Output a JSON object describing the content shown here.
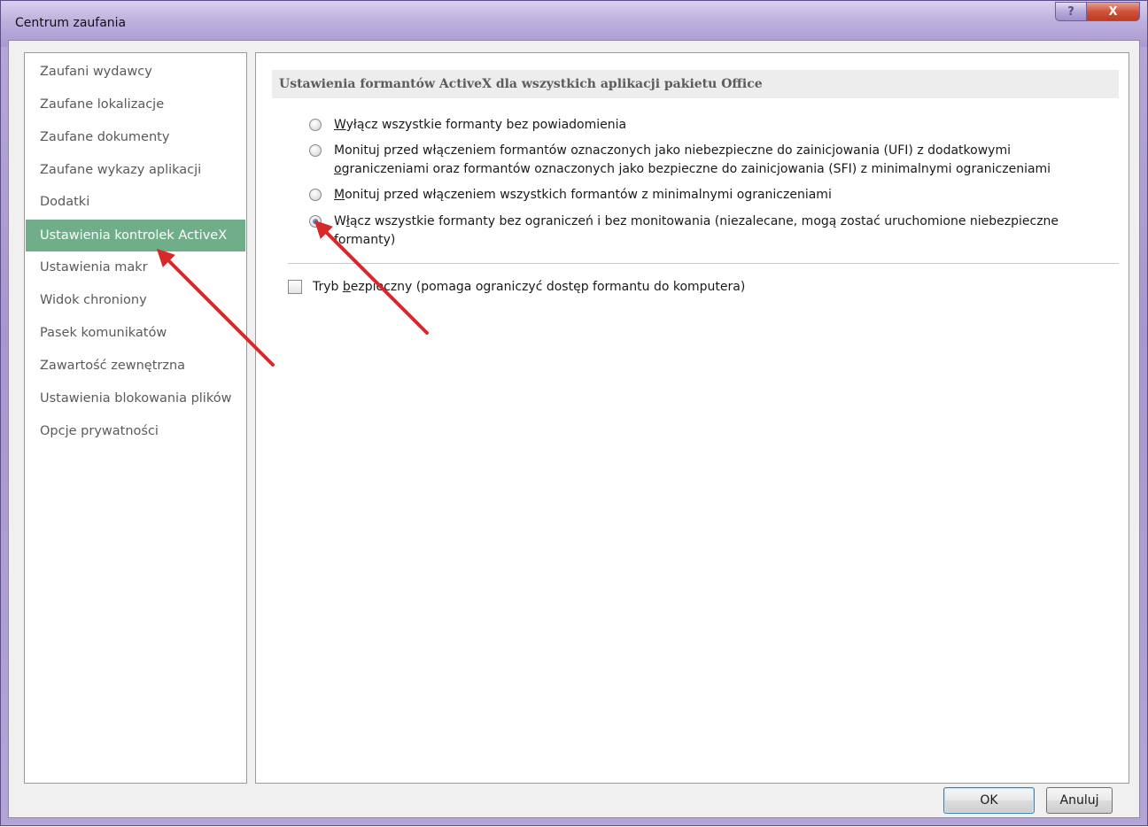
{
  "window": {
    "title": "Centrum zaufania",
    "help_label": "?",
    "close_label": "X"
  },
  "sidebar": {
    "items": [
      {
        "label": "Zaufani wydawcy",
        "selected": false
      },
      {
        "label": "Zaufane lokalizacje",
        "selected": false
      },
      {
        "label": "Zaufane dokumenty",
        "selected": false
      },
      {
        "label": "Zaufane wykazy aplikacji",
        "selected": false
      },
      {
        "label": "Dodatki",
        "selected": false
      },
      {
        "label": "Ustawienia kontrolek ActiveX",
        "selected": true
      },
      {
        "label": "Ustawienia makr",
        "selected": false
      },
      {
        "label": "Widok chroniony",
        "selected": false
      },
      {
        "label": "Pasek komunikatów",
        "selected": false
      },
      {
        "label": "Zawartość zewnętrzna",
        "selected": false
      },
      {
        "label": "Ustawienia blokowania plików",
        "selected": false
      },
      {
        "label": "Opcje prywatności",
        "selected": false
      }
    ]
  },
  "main": {
    "section_title": "Ustawienia formantów ActiveX dla wszystkich aplikacji pakietu Office",
    "options": [
      {
        "access_key": "W",
        "rest": "yłącz wszystkie formanty bez powiadomienia",
        "selected": false
      },
      {
        "line1": "Monituj przed włączeniem formantów oznaczonych jako niebezpieczne do zainicjowania (UFI) z dodatkowymi",
        "line2_key": "o",
        "line2_rest": "graniczeniami oraz formantów oznaczonych jako bezpieczne do zainicjowania (SFI) z minimalnymi ograniczeniami",
        "selected": false
      },
      {
        "access_key": "M",
        "rest": "onituj przed włączeniem wszystkich formantów z minimalnymi ograniczeniami",
        "selected": false
      },
      {
        "line1_pre": "W",
        "line1_key": "ł",
        "line1_rest": "ącz wszystkie formanty bez ograniczeń i bez monitowania (niezalecane, mogą zostać uruchomione niebezpieczne",
        "line2": "formanty)",
        "selected": true
      }
    ],
    "safe_mode": {
      "pre": "Tryb ",
      "key": "b",
      "rest": "ezpieczny (pomaga ograniczyć dostęp formantu do komputera)",
      "checked": false
    }
  },
  "buttons": {
    "ok": "OK",
    "cancel": "Anuluj"
  },
  "colors": {
    "selected_nav": "#6fae88",
    "annotation_arrow": "#d42a2a"
  }
}
